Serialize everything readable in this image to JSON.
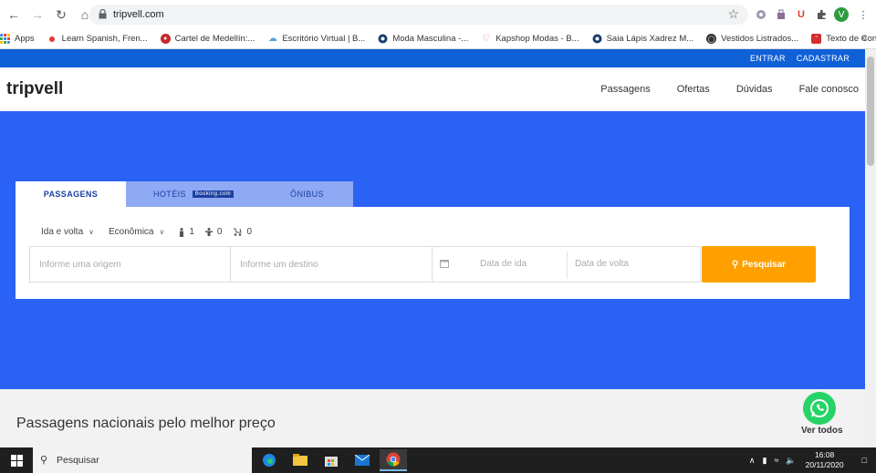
{
  "browser": {
    "url": "tripvell.com",
    "avatar_letter": "V",
    "bookmarks": [
      {
        "label": "Apps",
        "icon": "apps-grid-icon",
        "color": "#4285f4"
      },
      {
        "label": "Learn Spanish, Fren...",
        "icon": "red-dot-icon",
        "color": "#e53935"
      },
      {
        "label": "Cartel de Medellín:...",
        "icon": "red-circle-icon",
        "color": "#c62828"
      },
      {
        "label": "Escritório Virtual | B...",
        "icon": "cloud-icon",
        "color": "#4aa3df"
      },
      {
        "label": "Moda Masculina -...",
        "icon": "target-icon",
        "color": "#1a3b6e"
      },
      {
        "label": "Kapshop Modas - B...",
        "icon": "heart-icon",
        "color": "#e57373"
      },
      {
        "label": "Saia Lápis Xadrez M...",
        "icon": "target-icon",
        "color": "#1a3b6e"
      },
      {
        "label": "Vestidos Listrados...",
        "icon": "globe-icon",
        "color": "#333333"
      },
      {
        "label": "Texto de Conquista...",
        "icon": "quote-icon",
        "color": "#d32f2f"
      }
    ],
    "more": "»"
  },
  "site": {
    "top_links": {
      "login": "ENTRAR",
      "register": "CADASTRAR"
    },
    "logo": "tripvell",
    "menu": [
      "Passagens",
      "Ofertas",
      "Dúvidas",
      "Fale conosco"
    ],
    "tabs": {
      "flights": "PASSAGENS",
      "hotels": "HOTÉIS",
      "booking": "Booking.com",
      "bus": "ÔNIBUS"
    },
    "options": {
      "trip_type": "Ida e volta",
      "cabin": "Econômica",
      "adults": "1",
      "children": "0",
      "infants": "0"
    },
    "fields": {
      "origin_placeholder": "Informe uma origem",
      "destination_placeholder": "Informe um destino",
      "depart_placeholder": "Data de ida",
      "return_placeholder": "Data de volta"
    },
    "search_button": "Pesquisar",
    "section_title": "Passagens nacionais pelo melhor preço",
    "whatsapp_label": "Ver todos",
    "colors": {
      "brand_blue": "#2a62f5",
      "topbar": "#1060d8",
      "search_orange": "#ffa000"
    }
  },
  "taskbar": {
    "search_placeholder": "Pesquisar",
    "time": "16:08",
    "date": "20/11/2020"
  }
}
